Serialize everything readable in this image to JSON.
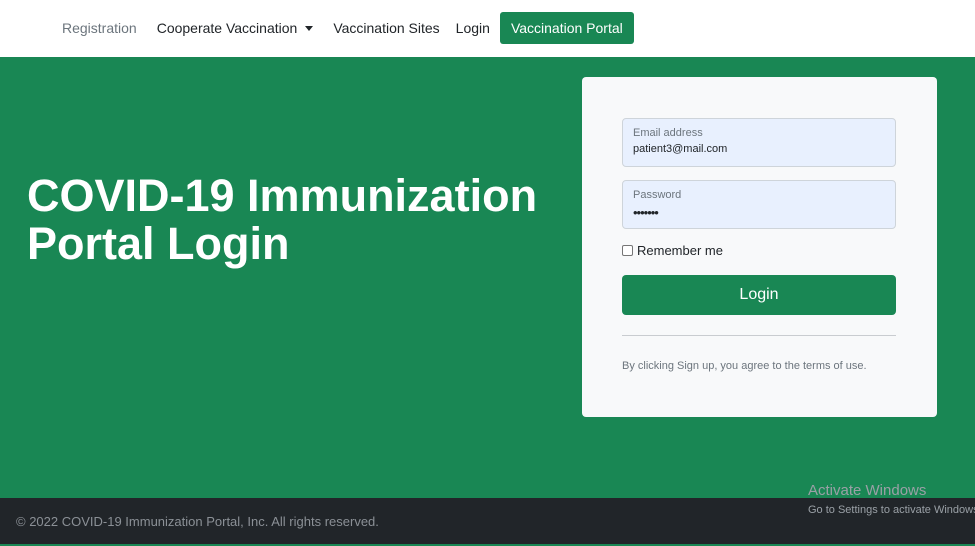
{
  "nav": {
    "items": [
      {
        "label": "Registration"
      },
      {
        "label": "Cooperate Vaccination"
      },
      {
        "label": "Vaccination Sites"
      },
      {
        "label": "Login"
      }
    ],
    "portal_button": "Vaccination Portal"
  },
  "hero": {
    "title": "COVID-19 Immunization Portal Login"
  },
  "login_form": {
    "email_label": "Email address",
    "email_value": "patient3@mail.com",
    "password_label": "Password",
    "password_value": "•••••••",
    "remember_label": "Remember me",
    "remember_checked": false,
    "submit_label": "Login",
    "terms_text": "By clicking Sign up, you agree to the terms of use."
  },
  "footer": {
    "copyright": "© 2022 COVID-19 Immunization Portal, Inc. All rights reserved."
  },
  "watermark": {
    "title": "Activate Windows",
    "subtitle": "Go to Settings to activate Windows."
  },
  "colors": {
    "brand_green": "#198754",
    "footer_dark": "#212529",
    "input_autofill": "#e8f0fe"
  }
}
